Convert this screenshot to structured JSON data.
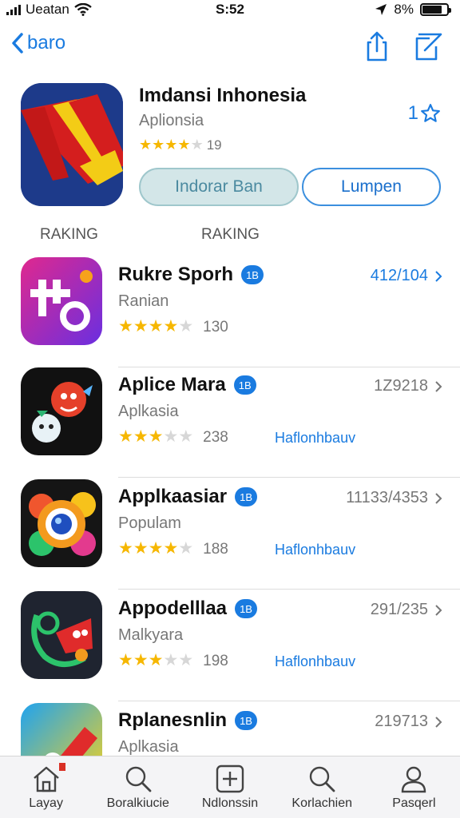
{
  "status_bar": {
    "carrier": "Ueatan",
    "time": "S:52",
    "battery": "8%",
    "battery_level": 0.8
  },
  "nav": {
    "back_label": "baro",
    "share_icon": "share-icon",
    "compose_icon": "compose-icon"
  },
  "featured": {
    "title": "Imdansi Inhonesia",
    "subtitle": "Aplionsia",
    "rating_stars": 4,
    "rating_count": "19",
    "rank": "1",
    "install_label": "Indorar Ban",
    "open_label": "Lumpen"
  },
  "sections": {
    "left": "RAKING",
    "right": "RAKING"
  },
  "apps": [
    {
      "name": "Rukre Sporh",
      "tag": "1B",
      "category": "Ranian",
      "stars": 4,
      "count": "130",
      "link": "",
      "rank": "412/104",
      "rank_color": "blue"
    },
    {
      "name": "Aplice Mara",
      "tag": "1B",
      "category": "Aplkasia",
      "stars": 3,
      "count": "238",
      "link": "Haflonhbauv",
      "rank": "1Z9218",
      "rank_color": "gray"
    },
    {
      "name": "Applkaasiar",
      "tag": "1B",
      "category": "Populam",
      "stars": 4,
      "count": "188",
      "link": "Haflonhbauv",
      "rank": "11133/4353",
      "rank_color": "gray"
    },
    {
      "name": "Appodelllaa",
      "tag": "1B",
      "category": "Malkyara",
      "stars": 3,
      "count": "198",
      "link": "Haflonhbauv",
      "rank": "291/235",
      "rank_color": "gray"
    },
    {
      "name": "Rplanesnlin",
      "tag": "1B",
      "category": "Aplkasia",
      "stars": 0,
      "count": "",
      "link": "",
      "rank": "219713",
      "rank_color": "gray"
    }
  ],
  "tabs": [
    {
      "label": "Layay",
      "icon": "home-icon"
    },
    {
      "label": "Boralkiucie",
      "icon": "search-icon"
    },
    {
      "label": "Ndlonssin",
      "icon": "add-icon"
    },
    {
      "label": "Korlachien",
      "icon": "search-icon"
    },
    {
      "label": "Pasqerl",
      "icon": "profile-icon"
    }
  ],
  "colors": {
    "accent": "#1a7be0",
    "star": "#f6b700",
    "install_bg": "#d3e6e8"
  }
}
